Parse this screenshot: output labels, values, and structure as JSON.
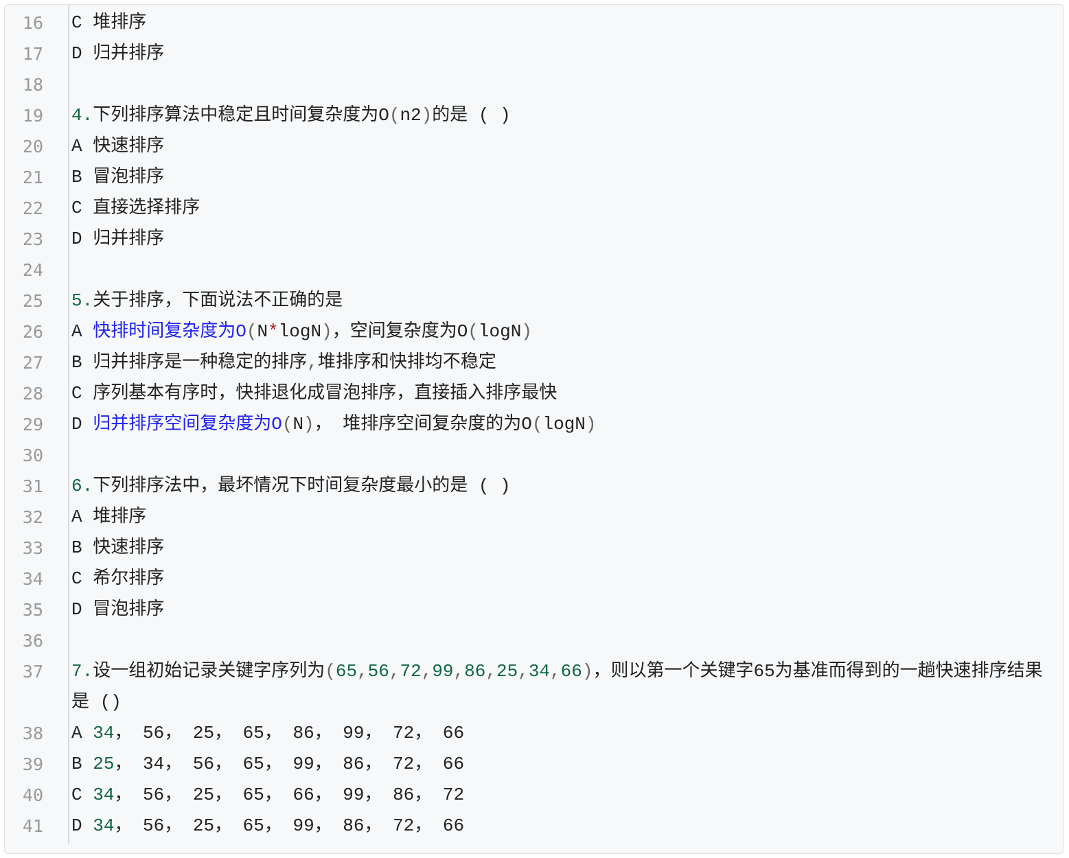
{
  "lines": [
    {
      "n": "16",
      "parts": [
        {
          "t": "C 堆排序"
        }
      ]
    },
    {
      "n": "17",
      "parts": [
        {
          "t": "D 归并排序"
        }
      ]
    },
    {
      "n": "18",
      "parts": [
        {
          "t": ""
        }
      ]
    },
    {
      "n": "19",
      "parts": [
        {
          "t": "4.",
          "c": "num"
        },
        {
          "t": "下列排序算法中稳定且时间复杂度为O"
        },
        {
          "t": "(",
          "c": "paren"
        },
        {
          "t": "n2"
        },
        {
          "t": ")",
          "c": "paren"
        },
        {
          "t": "的是 ( )"
        }
      ]
    },
    {
      "n": "20",
      "parts": [
        {
          "t": "A 快速排序"
        }
      ]
    },
    {
      "n": "21",
      "parts": [
        {
          "t": "B 冒泡排序"
        }
      ]
    },
    {
      "n": "22",
      "parts": [
        {
          "t": "C 直接选择排序"
        }
      ]
    },
    {
      "n": "23",
      "parts": [
        {
          "t": "D 归并排序"
        }
      ]
    },
    {
      "n": "24",
      "parts": [
        {
          "t": ""
        }
      ]
    },
    {
      "n": "25",
      "parts": [
        {
          "t": "5.",
          "c": "num"
        },
        {
          "t": "关于排序，下面说法不正确的是"
        }
      ]
    },
    {
      "n": "26",
      "parts": [
        {
          "t": "A "
        },
        {
          "t": "快排时间复杂度为O",
          "c": "blue"
        },
        {
          "t": "(",
          "c": "paren"
        },
        {
          "t": "N"
        },
        {
          "t": "*",
          "c": "red"
        },
        {
          "t": "logN"
        },
        {
          "t": ")",
          "c": "paren"
        },
        {
          "t": "，空间复杂度为O"
        },
        {
          "t": "(",
          "c": "paren"
        },
        {
          "t": "logN"
        },
        {
          "t": ")",
          "c": "paren"
        }
      ]
    },
    {
      "n": "27",
      "parts": [
        {
          "t": "B 归并排序是一种稳定的排序"
        },
        {
          "t": ",",
          "c": "paren"
        },
        {
          "t": "堆排序和快排均不稳定"
        }
      ]
    },
    {
      "n": "28",
      "parts": [
        {
          "t": "C 序列基本有序时，快排退化成冒泡排序，直接插入排序最快"
        }
      ]
    },
    {
      "n": "29",
      "parts": [
        {
          "t": "D "
        },
        {
          "t": "归并排序空间复杂度为O",
          "c": "blue"
        },
        {
          "t": "(",
          "c": "paren"
        },
        {
          "t": "N"
        },
        {
          "t": ")",
          "c": "paren"
        },
        {
          "t": "， 堆排序空间复杂度的为O"
        },
        {
          "t": "(",
          "c": "paren"
        },
        {
          "t": "logN"
        },
        {
          "t": ")",
          "c": "paren"
        }
      ]
    },
    {
      "n": "30",
      "parts": [
        {
          "t": ""
        }
      ]
    },
    {
      "n": "31",
      "parts": [
        {
          "t": "6.",
          "c": "num"
        },
        {
          "t": "下列排序法中，最坏情况下时间复杂度最小的是 ( )"
        }
      ]
    },
    {
      "n": "32",
      "parts": [
        {
          "t": "A 堆排序"
        }
      ]
    },
    {
      "n": "33",
      "parts": [
        {
          "t": "B 快速排序"
        }
      ]
    },
    {
      "n": "34",
      "parts": [
        {
          "t": "C 希尔排序"
        }
      ]
    },
    {
      "n": "35",
      "parts": [
        {
          "t": "D 冒泡排序"
        }
      ]
    },
    {
      "n": "36",
      "parts": [
        {
          "t": ""
        }
      ]
    },
    {
      "n": "37",
      "parts": [
        {
          "t": "7.",
          "c": "num"
        },
        {
          "t": "设一组初始记录关键字序列为"
        },
        {
          "t": "(",
          "c": "paren"
        },
        {
          "t": "65",
          "c": "num"
        },
        {
          "t": ",",
          "c": "paren"
        },
        {
          "t": "56",
          "c": "num"
        },
        {
          "t": ",",
          "c": "paren"
        },
        {
          "t": "72",
          "c": "num"
        },
        {
          "t": ",",
          "c": "paren"
        },
        {
          "t": "99",
          "c": "num"
        },
        {
          "t": ",",
          "c": "paren"
        },
        {
          "t": "86",
          "c": "num"
        },
        {
          "t": ",",
          "c": "paren"
        },
        {
          "t": "25",
          "c": "num"
        },
        {
          "t": ",",
          "c": "paren"
        },
        {
          "t": "34",
          "c": "num"
        },
        {
          "t": ",",
          "c": "paren"
        },
        {
          "t": "66",
          "c": "num"
        },
        {
          "t": ")",
          "c": "paren"
        },
        {
          "t": "，则以第一个关键字65为基准而得到的一趟快速排序结果是 ()"
        }
      ]
    },
    {
      "n": "38",
      "parts": [
        {
          "t": "A "
        },
        {
          "t": "34",
          "c": "num"
        },
        {
          "t": "， 56， 25， 65， 86， 99， 72， 66"
        }
      ]
    },
    {
      "n": "39",
      "parts": [
        {
          "t": "B "
        },
        {
          "t": "25",
          "c": "num"
        },
        {
          "t": "， 34， 56， 65， 99， 86， 72， 66"
        }
      ]
    },
    {
      "n": "40",
      "parts": [
        {
          "t": "C "
        },
        {
          "t": "34",
          "c": "num"
        },
        {
          "t": "， 56， 25， 65， 66， 99， 86， 72"
        }
      ]
    },
    {
      "n": "41",
      "parts": [
        {
          "t": "D "
        },
        {
          "t": "34",
          "c": "num"
        },
        {
          "t": "， 56， 25， 65， 99， 86， 72， 66"
        }
      ]
    }
  ]
}
